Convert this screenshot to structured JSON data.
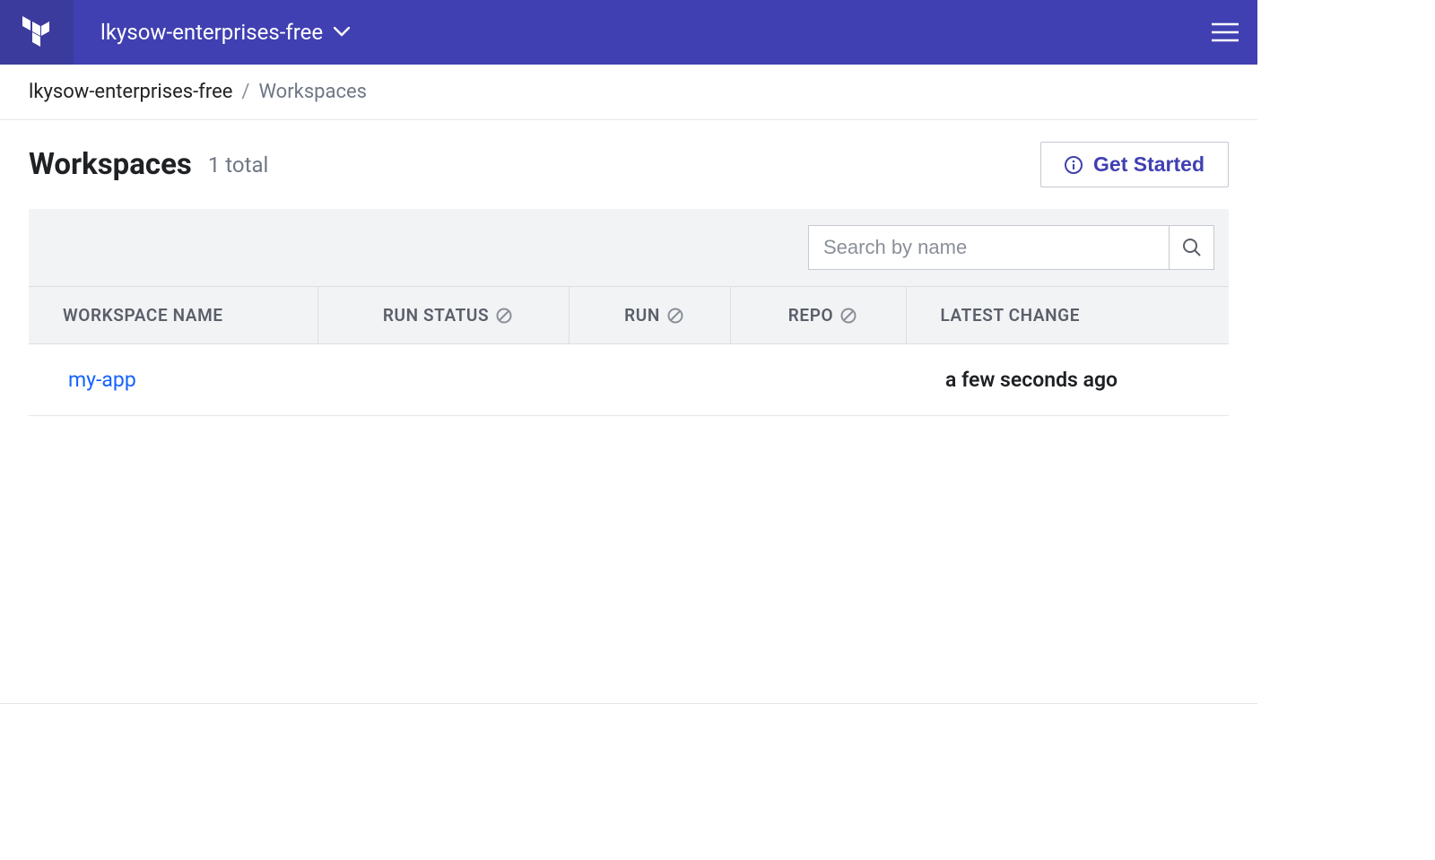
{
  "header": {
    "org_name": "lkysow-enterprises-free"
  },
  "breadcrumb": {
    "org": "lkysow-enterprises-free",
    "current": "Workspaces"
  },
  "page": {
    "title": "Workspaces",
    "count_label": "1 total",
    "get_started_label": "Get Started"
  },
  "search": {
    "placeholder": "Search by name"
  },
  "columns": {
    "name": "WORKSPACE NAME",
    "run_status": "RUN STATUS",
    "run": "RUN",
    "repo": "REPO",
    "latest_change": "LATEST CHANGE"
  },
  "workspaces": [
    {
      "name": "my-app",
      "run_status": "",
      "run": "",
      "repo": "",
      "latest_change": "a few seconds ago"
    }
  ]
}
